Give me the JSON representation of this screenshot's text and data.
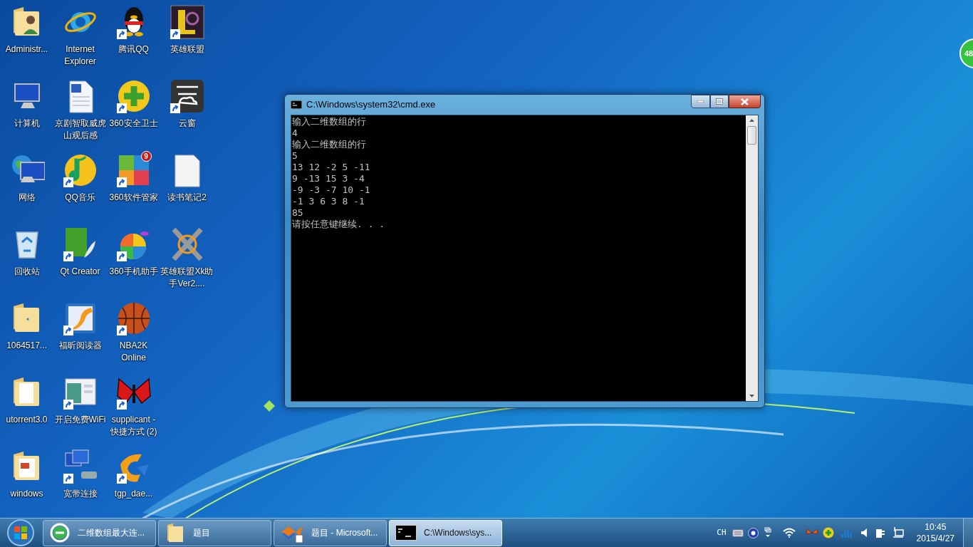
{
  "desktop": {
    "columns": [
      [
        {
          "label": "Administr...",
          "shortcut": false
        },
        {
          "label": "计算机",
          "shortcut": false
        },
        {
          "label": "网络",
          "shortcut": false
        },
        {
          "label": "回收站",
          "shortcut": false
        },
        {
          "label": "1064517...",
          "shortcut": false
        },
        {
          "label": "utorrent3.0",
          "shortcut": false
        },
        {
          "label": "windows",
          "shortcut": false
        }
      ],
      [
        {
          "label": "Internet Explorer",
          "shortcut": false
        },
        {
          "label": "京剧智取威虎山观后感",
          "shortcut": false
        },
        {
          "label": "QQ音乐",
          "shortcut": true
        },
        {
          "label": "Qt Creator",
          "shortcut": true
        },
        {
          "label": "福昕阅读器",
          "shortcut": true
        },
        {
          "label": "开启免费WiFi",
          "shortcut": true
        },
        {
          "label": "宽带连接",
          "shortcut": true
        }
      ],
      [
        {
          "label": "腾讯QQ",
          "shortcut": true
        },
        {
          "label": "360安全卫士",
          "shortcut": true
        },
        {
          "label": "360软件管家",
          "shortcut": true,
          "badge": "9"
        },
        {
          "label": "360手机助手",
          "shortcut": true
        },
        {
          "label": "NBA2K Online",
          "shortcut": true
        },
        {
          "label": "supplicant - 快捷方式 (2)",
          "shortcut": true
        },
        {
          "label": "tgp_dae...",
          "shortcut": true
        }
      ],
      [
        {
          "label": "英雄联盟",
          "shortcut": true
        },
        {
          "label": "云窗",
          "shortcut": true
        },
        {
          "label": "读书笔记2",
          "shortcut": false
        },
        {
          "label": "英雄联盟Xk助手Ver2....",
          "shortcut": false
        }
      ]
    ]
  },
  "floating_badge": {
    "label": "48"
  },
  "window": {
    "title": "C:\\Windows\\system32\\cmd.exe",
    "lines": [
      "输入二维数组的行",
      "4",
      "输入二维数组的行",
      "5",
      "13 12 -2 5 -11",
      "9 -13 15 3 -4",
      "-9 -3 -7 10 -1",
      "-1 3 6 3 8 -1",
      "85",
      "请按任意键继续. . ."
    ]
  },
  "taskbar": {
    "buttons": [
      {
        "label": "二维数组最大连...",
        "selected": false
      },
      {
        "label": "题目",
        "selected": false
      },
      {
        "label": "题目 - Microsoft...",
        "selected": false
      },
      {
        "label": "C:\\Windows\\sys...",
        "selected": true
      }
    ],
    "language": "CH",
    "clock": {
      "time": "10:45",
      "date": "2015/4/27"
    }
  }
}
